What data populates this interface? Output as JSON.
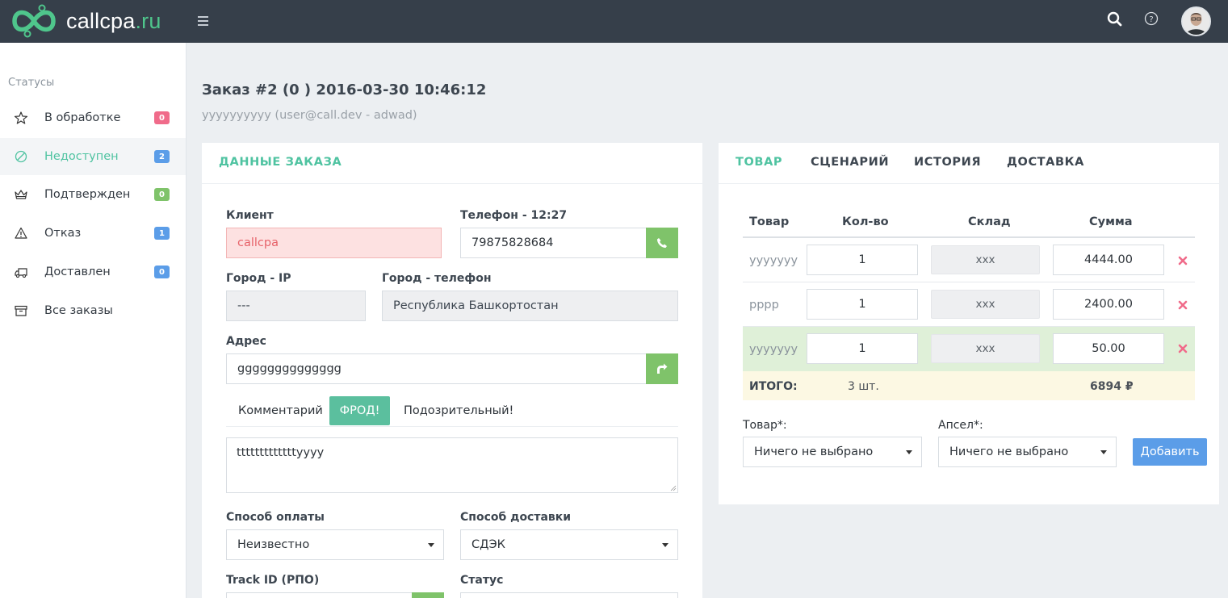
{
  "brand": {
    "name": "callcpa",
    "tld": ".ru"
  },
  "colors": {
    "topbar": "#363f4a",
    "accent": "#4fc3a1",
    "green": "#7fc36a",
    "blue": "#5b9de8",
    "pink": "#f06b8a"
  },
  "topbar": {
    "icons": [
      "menu-icon",
      "search-icon",
      "help-icon",
      "user-avatar"
    ]
  },
  "sidebar": {
    "title": "Статусы",
    "items": [
      {
        "label": "В обработке",
        "badge": "0",
        "badge_color": "#f06b8a",
        "icon": "star-icon"
      },
      {
        "label": "Недоступен",
        "badge": "2",
        "badge_color": "#5b9de8",
        "icon": "ban-icon"
      },
      {
        "label": "Подтвержден",
        "badge": "0",
        "badge_color": "#7fc36a",
        "icon": "crown-icon"
      },
      {
        "label": "Отказ",
        "badge": "1",
        "badge_color": "#5b9de8",
        "icon": "warning-icon"
      },
      {
        "label": "Доставлен",
        "badge": "0",
        "badge_color": "#5b9de8",
        "icon": "truck-icon"
      },
      {
        "label": "Все заказы",
        "badge": null,
        "icon": "archive-icon"
      }
    ]
  },
  "header": {
    "title_prefix": "Заказ",
    "title_rest": " #2 (0 ) 2016-03-30 10:46:12",
    "subtitle": "yyyyyyyyyy (user@call.dev - adwad)"
  },
  "order": {
    "card_title": "ДАННЫЕ ЗАКАЗА",
    "client_label": "Клиент",
    "client_value": "callcpa",
    "phone_label": "Телефон - 12:27",
    "phone_value": "79875828684",
    "city_ip_label": "Город - IP",
    "city_ip_value": "---",
    "city_phone_label": "Город - телефон",
    "city_phone_value": "Республика Башкортостан",
    "address_label": "Адрес",
    "address_value": "gggggggggggggg",
    "comment_tabs": {
      "comment": "Комментарий",
      "fraud": "ФРОД!",
      "suspicious": "Подозрительный!"
    },
    "comment_value": "tttttttttttttyyyy",
    "payment_label": "Способ оплаты",
    "payment_value": "Неизвестно",
    "delivery_label": "Способ доставки",
    "delivery_value": "СДЭК",
    "track_label": "Track ID (РПО)",
    "status_label": "Статус"
  },
  "product": {
    "tabs": [
      "ТОВАР",
      "СЦЕНАРИЙ",
      "ИСТОРИЯ",
      "ДОСТАВКА"
    ],
    "columns": [
      "Товар",
      "Кол-во",
      "Склад",
      "Сумма"
    ],
    "rows": [
      {
        "name": "yyyyyyy",
        "qty": "1",
        "store": "xxx",
        "sum": "4444.00"
      },
      {
        "name": "pppp",
        "qty": "1",
        "store": "xxx",
        "sum": "2400.00"
      },
      {
        "name": "yyyyyyy",
        "qty": "1",
        "store": "xxx",
        "sum": "50.00"
      }
    ],
    "total_label": "ИТОГО:",
    "total_qty": "3 шт.",
    "total_sum": "6894 ₽",
    "product_select_label": "Товар*:",
    "product_select_value": "Ничего не выбрано",
    "upsell_select_label": "Апсел*:",
    "upsell_select_value": "Ничего не выбрано",
    "add_button": "Добавить"
  }
}
